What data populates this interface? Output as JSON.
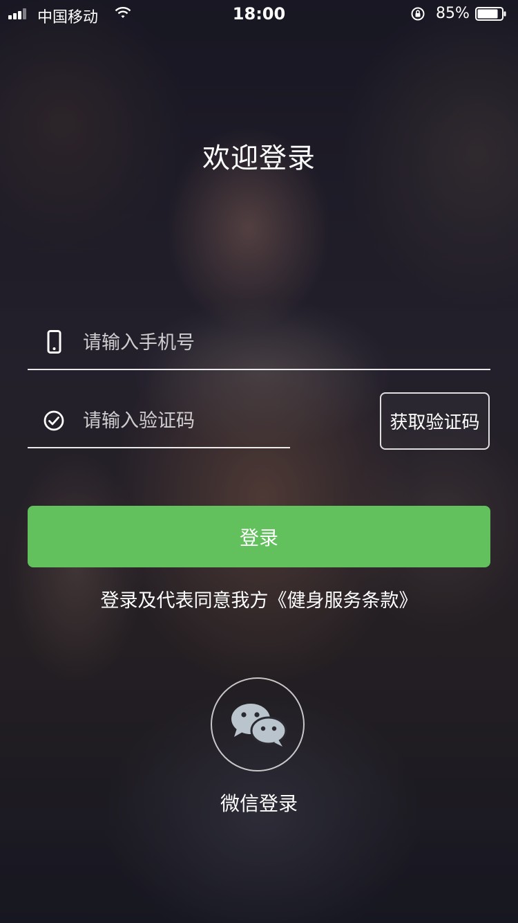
{
  "status_bar": {
    "carrier": "中国移动",
    "time": "18:00",
    "battery_percent": "85%",
    "battery_level": 0.85,
    "icons": [
      "signal-icon",
      "wifi-icon",
      "orientation-lock-icon",
      "battery-icon"
    ]
  },
  "login": {
    "title": "欢迎登录",
    "phone_placeholder": "请输入手机号",
    "phone_value": "",
    "code_placeholder": "请输入验证码",
    "code_value": "",
    "get_code_label": "获取验证码",
    "login_label": "登录",
    "terms_prefix": "登录及代表同意我方",
    "terms_link": "《健身服务条款》",
    "wechat_label": "微信登录",
    "phone_icon": "phone-icon",
    "code_icon": "check-circle-icon",
    "wechat_icon": "wechat-icon"
  },
  "colors": {
    "primary_button": "#62c15d",
    "text": "#ffffff"
  }
}
